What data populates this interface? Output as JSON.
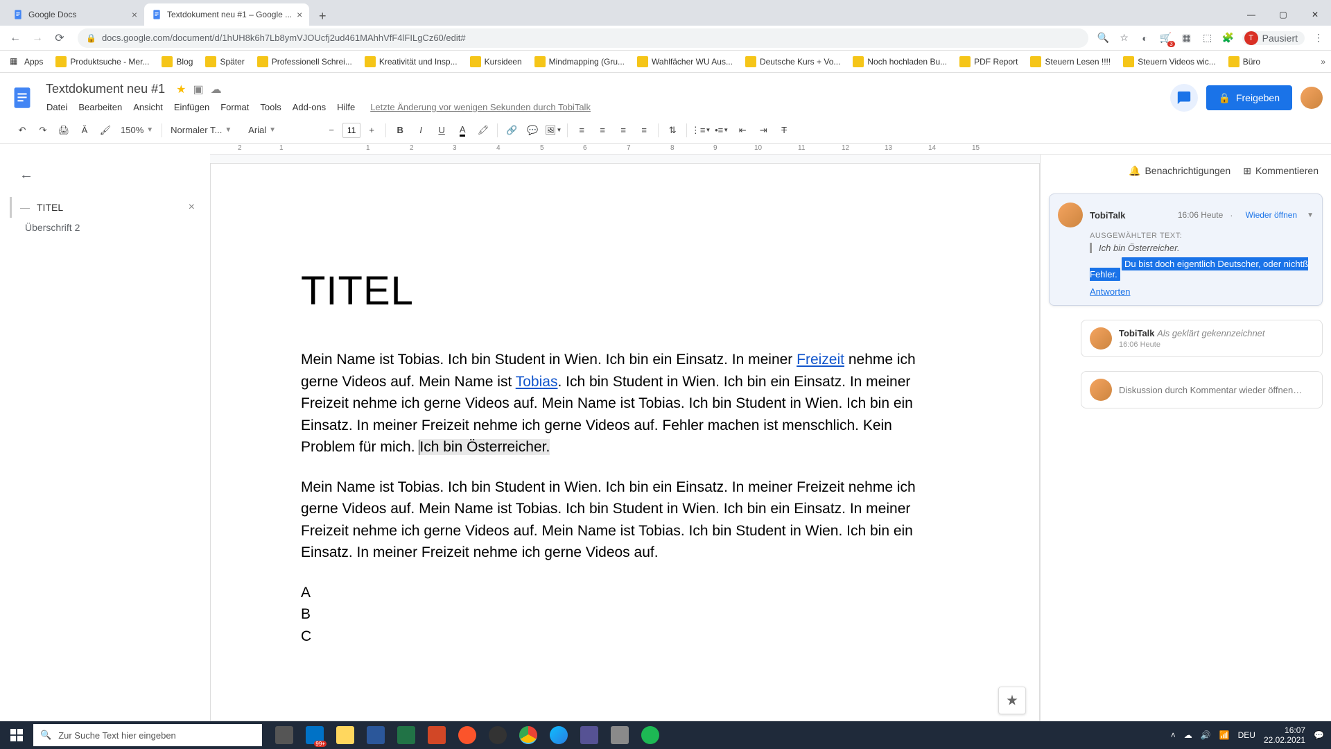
{
  "browser": {
    "tabs": [
      {
        "title": "Google Docs"
      },
      {
        "title": "Textdokument neu #1 – Google ..."
      }
    ],
    "url": "docs.google.com/document/d/1hUH8k6h7Lb8ymVJOUcfj2ud461MAhhVfF4lFILgCz60/edit#",
    "profile_label": "Pausiert",
    "profile_initial": "T"
  },
  "bookmarks": [
    "Apps",
    "Produktsuche - Mer...",
    "Blog",
    "Später",
    "Professionell Schrei...",
    "Kreativität und Insp...",
    "Kursideen",
    "Mindmapping (Gru...",
    "Wahlfächer WU Aus...",
    "Deutsche Kurs + Vo...",
    "Noch hochladen Bu...",
    "PDF Report",
    "Steuern Lesen !!!!",
    "Steuern Videos wic...",
    "Büro"
  ],
  "docs": {
    "title": "Textdokument neu #1",
    "menus": [
      "Datei",
      "Bearbeiten",
      "Ansicht",
      "Einfügen",
      "Format",
      "Tools",
      "Add-ons",
      "Hilfe"
    ],
    "last_edit": "Letzte Änderung vor wenigen Sekunden durch TobiTalk",
    "share": "Freigeben"
  },
  "toolbar": {
    "zoom": "150%",
    "style": "Normaler T...",
    "font": "Arial",
    "size": "11"
  },
  "ruler": [
    "2",
    "1",
    "",
    "1",
    "2",
    "3",
    "4",
    "5",
    "6",
    "7",
    "8",
    "9",
    "10",
    "11",
    "12",
    "13",
    "14",
    "15"
  ],
  "outline": {
    "l1": "TITEL",
    "l2": "Überschrift 2"
  },
  "document": {
    "heading": "TITEL",
    "p1a": "Mein Name ist Tobias. Ich bin Student in Wien. Ich bin ein Einsatz. In meiner ",
    "link1": "Freizeit",
    "p1b": " nehme ich gerne Videos auf. Mein Name ist ",
    "link2": "Tobias",
    "p1c": ". Ich bin Student in Wien. Ich bin ein Einsatz. In meiner Freizeit nehme ich gerne Videos auf. Mein Name ist Tobias. Ich bin Student in Wien. Ich bin ein Einsatz. In meiner Freizeit nehme ich gerne Videos auf. Fehler machen ist menschlich. Kein Problem für mich. ",
    "highlight": "Ich bin Österreicher.",
    "p2": "Mein Name ist Tobias. Ich bin Student in Wien. Ich bin ein Einsatz. In meiner Freizeit nehme ich gerne Videos auf. Mein Name ist Tobias. Ich bin Student in Wien. Ich bin ein Einsatz. In meiner Freizeit nehme ich gerne Videos auf. Mein Name ist Tobias. Ich bin Student in Wien. Ich bin ein Einsatz. In meiner Freizeit nehme ich gerne Videos auf.",
    "lA": "A",
    "lB": "B",
    "lC": "C"
  },
  "comments": {
    "notifications": "Benachrichtigungen",
    "comment_btn": "Kommentieren",
    "author": "TobiTalk",
    "time": "16:06 Heute",
    "reopen": "Wieder öffnen",
    "sel_label": "AUSGEWÄHLTER TEXT:",
    "quote": "Ich bin Österreicher.",
    "body": "Du bist doch eigentlich Deutscher, oder nichtß Fehler.",
    "reply_link": "Antworten",
    "resolved_author": "TobiTalk",
    "resolved_status": "Als geklärt gekennzeichnet",
    "resolved_time": "16:06 Heute",
    "reply_placeholder": "Diskussion durch Kommentar wieder öffnen…"
  },
  "taskbar": {
    "search_placeholder": "Zur Suche Text hier eingeben",
    "badge": "99+",
    "lang": "DEU",
    "time": "16:07",
    "date": "22.02.2021"
  }
}
